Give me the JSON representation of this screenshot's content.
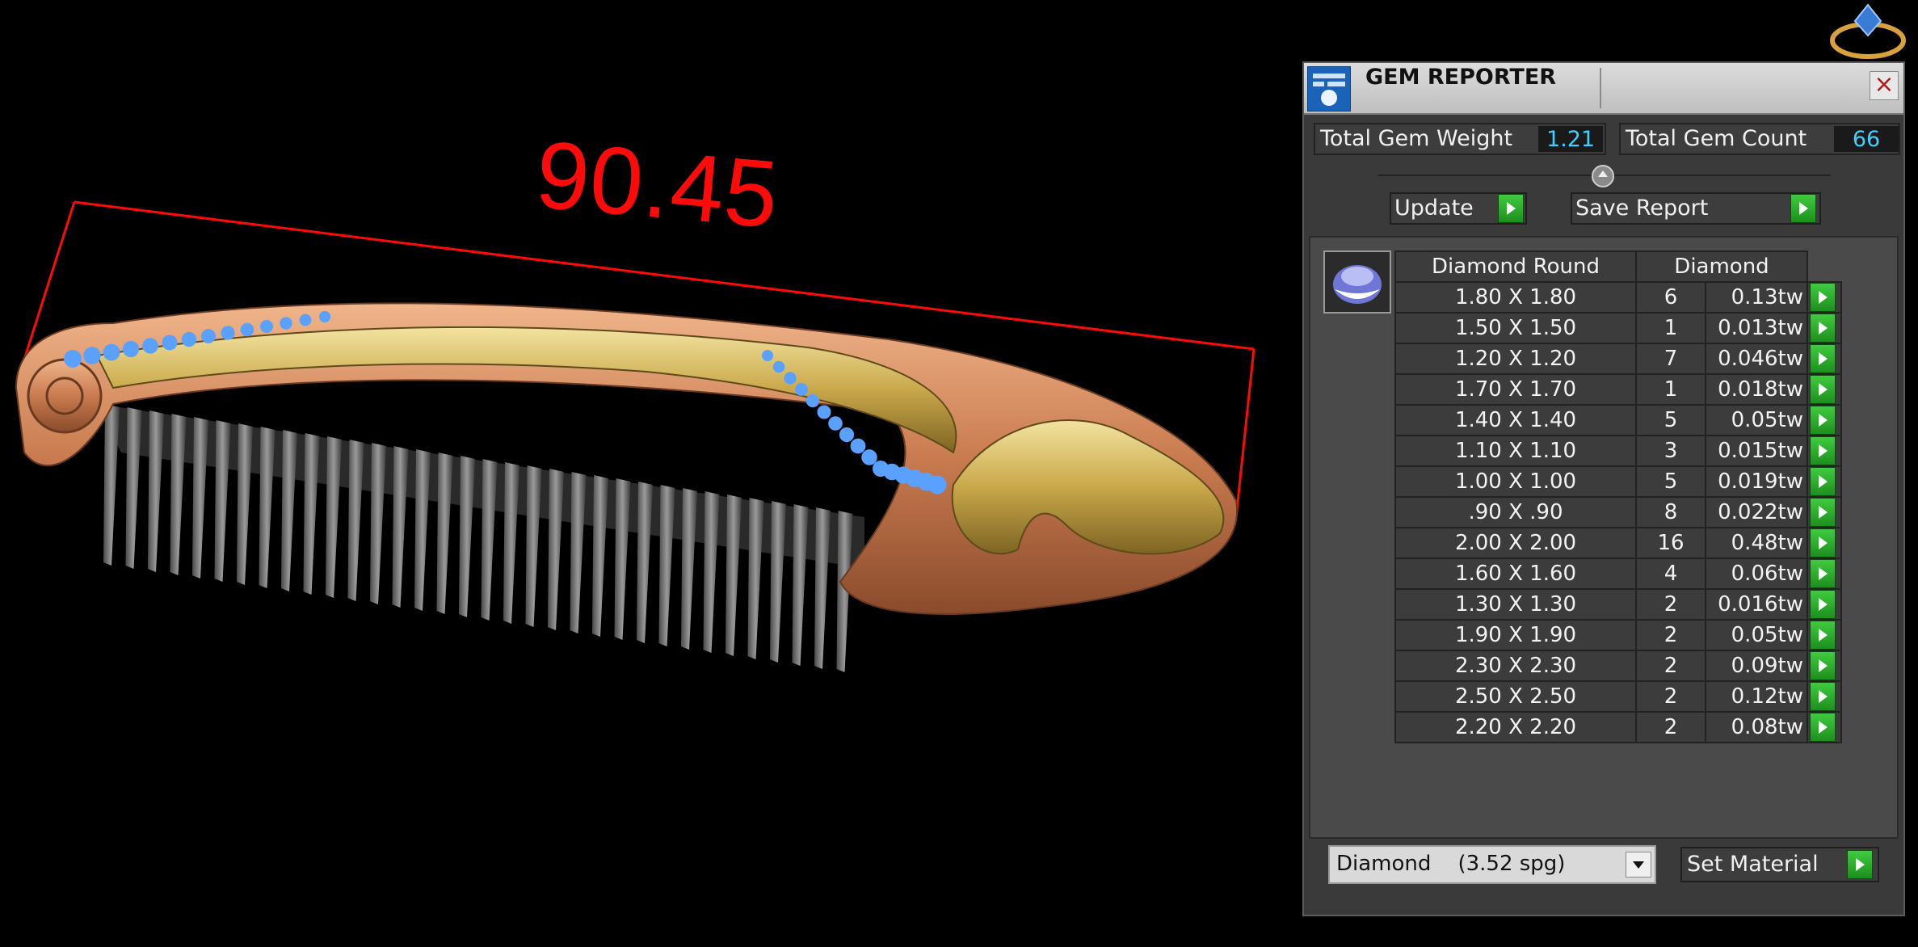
{
  "viewport": {
    "dimension_value": "90.45",
    "colors": {
      "dimension": "#ff0a0a",
      "gold": "#c9a84a",
      "rose_gold": "#d28a5c",
      "gem_blue": "#5aa0ff",
      "teeth": "#7a7a7a"
    }
  },
  "panel": {
    "title": "GEM REPORTER",
    "total_weight_label": "Total Gem Weight",
    "total_weight_value": "1.21",
    "total_count_label": "Total Gem Count",
    "total_count_value": "66",
    "update_label": "Update",
    "save_report_label": "Save Report",
    "table": {
      "col_shape": "Diamond Round",
      "col_material": "Diamond",
      "rows": [
        {
          "size": "1.80 X 1.80",
          "count": "6",
          "weight": "0.13tw"
        },
        {
          "size": "1.50 X 1.50",
          "count": "1",
          "weight": "0.013tw"
        },
        {
          "size": "1.20 X 1.20",
          "count": "7",
          "weight": "0.046tw"
        },
        {
          "size": "1.70 X 1.70",
          "count": "1",
          "weight": "0.018tw"
        },
        {
          "size": "1.40 X 1.40",
          "count": "5",
          "weight": "0.05tw"
        },
        {
          "size": "1.10 X 1.10",
          "count": "3",
          "weight": "0.015tw"
        },
        {
          "size": "1.00 X 1.00",
          "count": "5",
          "weight": "0.019tw"
        },
        {
          "size": ".90 X .90",
          "count": "8",
          "weight": "0.022tw"
        },
        {
          "size": "2.00 X 2.00",
          "count": "16",
          "weight": "0.48tw"
        },
        {
          "size": "1.60 X 1.60",
          "count": "4",
          "weight": "0.06tw"
        },
        {
          "size": "1.30 X 1.30",
          "count": "2",
          "weight": "0.016tw"
        },
        {
          "size": "1.90 X 1.90",
          "count": "2",
          "weight": "0.05tw"
        },
        {
          "size": "2.30 X 2.30",
          "count": "2",
          "weight": "0.09tw"
        },
        {
          "size": "2.50 X 2.50",
          "count": "2",
          "weight": "0.12tw"
        },
        {
          "size": "2.20 X 2.20",
          "count": "2",
          "weight": "0.08tw"
        }
      ]
    },
    "material_select_value": "Diamond    (3.52 spg)",
    "set_material_label": "Set Material",
    "accent": "#2fb52f",
    "value_color": "#40d0ff"
  }
}
